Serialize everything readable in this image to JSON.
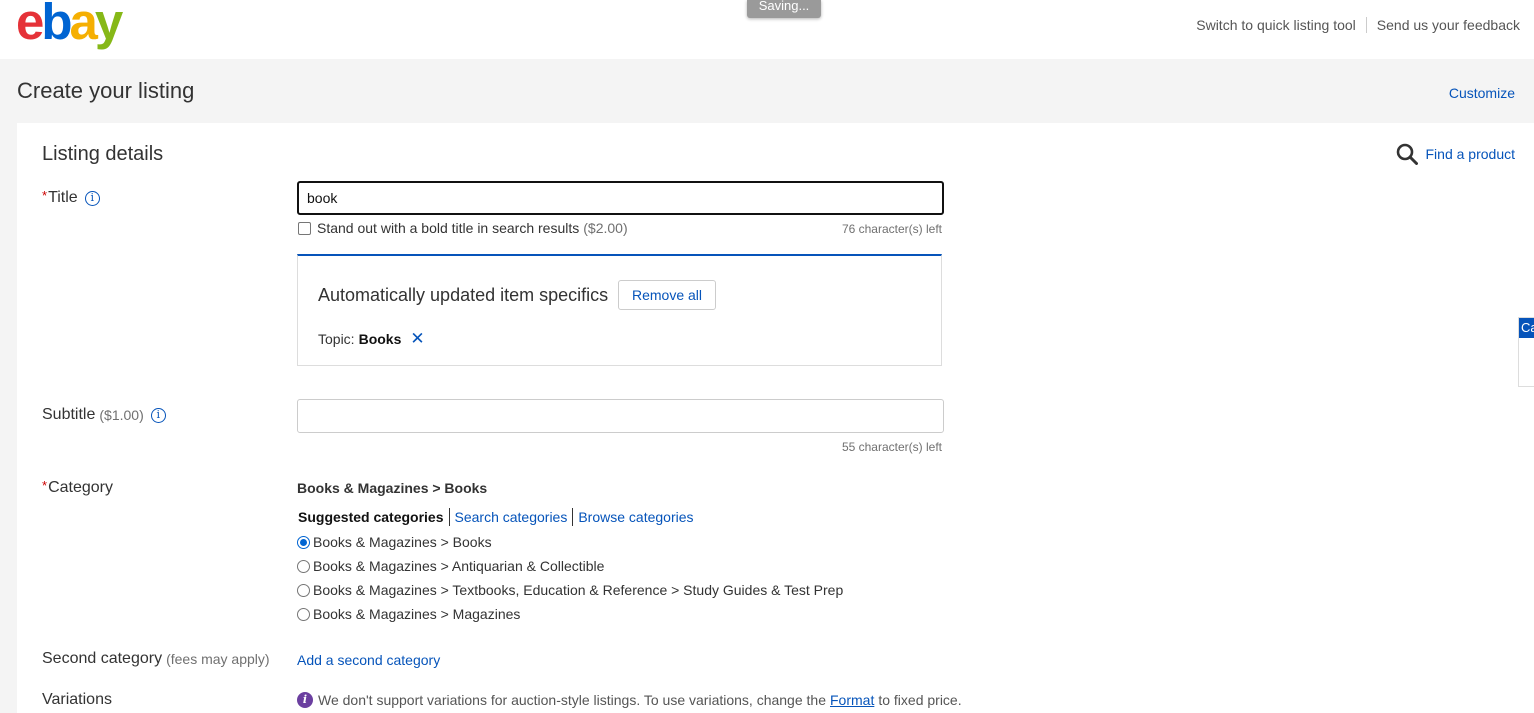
{
  "header": {
    "logo_letters": [
      "e",
      "b",
      "a",
      "y"
    ],
    "saving": "Saving...",
    "links": [
      "Switch to quick listing tool",
      "Send us your feedback"
    ]
  },
  "page": {
    "title": "Create your listing",
    "customize": "Customize"
  },
  "section": {
    "title": "Listing details",
    "find_product": "Find a product"
  },
  "title_field": {
    "required": "*",
    "label": "Title",
    "value": "book",
    "bold_option": "Stand out with a bold title in search results",
    "bold_price": "($2.00)",
    "chars_left": "76 character(s) left"
  },
  "specifics": {
    "title": "Automatically updated item specifics",
    "remove_all": "Remove all",
    "topic_label": "Topic:",
    "topic_value": "Books",
    "remove_icon": "✕"
  },
  "subtitle_field": {
    "label": "Subtitle",
    "price": "($1.00)",
    "value": "",
    "chars_left": "55 character(s) left"
  },
  "category": {
    "required": "*",
    "label": "Category",
    "current": "Books & Magazines > Books",
    "tabs": [
      "Suggested categories",
      "Search categories",
      "Browse categories"
    ],
    "options": [
      {
        "label": "Books & Magazines > Books",
        "selected": true
      },
      {
        "label": "Books & Magazines > Antiquarian & Collectible",
        "selected": false
      },
      {
        "label": "Books & Magazines > Textbooks, Education & Reference > Study Guides & Test Prep",
        "selected": false
      },
      {
        "label": "Books & Magazines > Magazines",
        "selected": false
      }
    ]
  },
  "second_category": {
    "label": "Second category",
    "note": "(fees may apply)",
    "link": "Add a second category"
  },
  "variations": {
    "label": "Variations",
    "icon": "i",
    "text_before": "We don't support variations for auction-style listings. To use variations, change the",
    "link": "Format",
    "text_after": "to fixed price."
  },
  "side_tab": {
    "label": "Ca"
  },
  "colors": {
    "link": "#0654ba",
    "required": "#cc0000",
    "info": "#6b3fa0"
  }
}
